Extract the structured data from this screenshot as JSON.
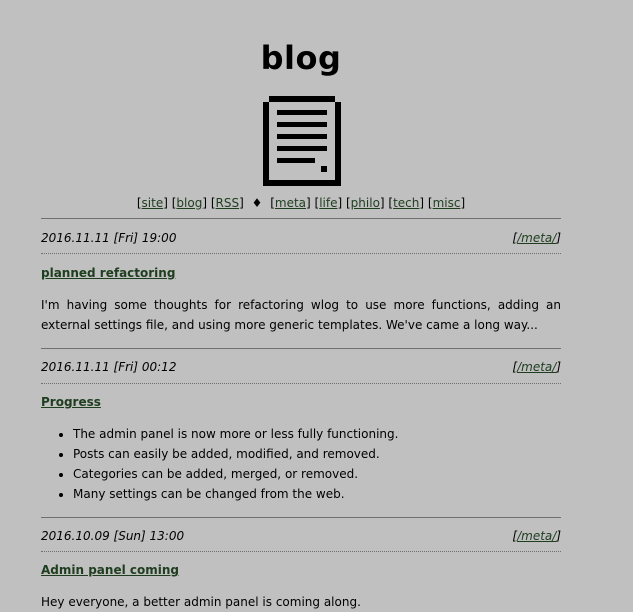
{
  "header": {
    "title": "blog",
    "logo_icon": "document-icon"
  },
  "nav": {
    "items": [
      {
        "label": "site"
      },
      {
        "label": "blog"
      },
      {
        "label": "RSS"
      },
      {
        "label": "meta"
      },
      {
        "label": "life"
      },
      {
        "label": "philo"
      },
      {
        "label": "tech"
      },
      {
        "label": "misc"
      }
    ],
    "separator": "♦"
  },
  "posts": [
    {
      "date": "2016.11.11 [Fri] 19:00",
      "category": "/meta/",
      "title": "planned refactoring",
      "body": "I'm having some thoughts for refactoring wlog to use more functions, adding an external settings file, and using more generic templates. We've came a long way..."
    },
    {
      "date": "2016.11.11 [Fri] 00:12",
      "category": "/meta/",
      "title": "Progress",
      "items": [
        "The admin panel is now more or less fully functioning.",
        "Posts can easily be added, modified, and removed.",
        "Categories can be added, merged, or removed.",
        "Many settings can be changed from the web."
      ]
    },
    {
      "date": "2016.10.09 [Sun] 13:00",
      "category": "/meta/",
      "title": "Admin panel coming",
      "body": "Hey everyone, a better admin panel is coming along."
    }
  ]
}
